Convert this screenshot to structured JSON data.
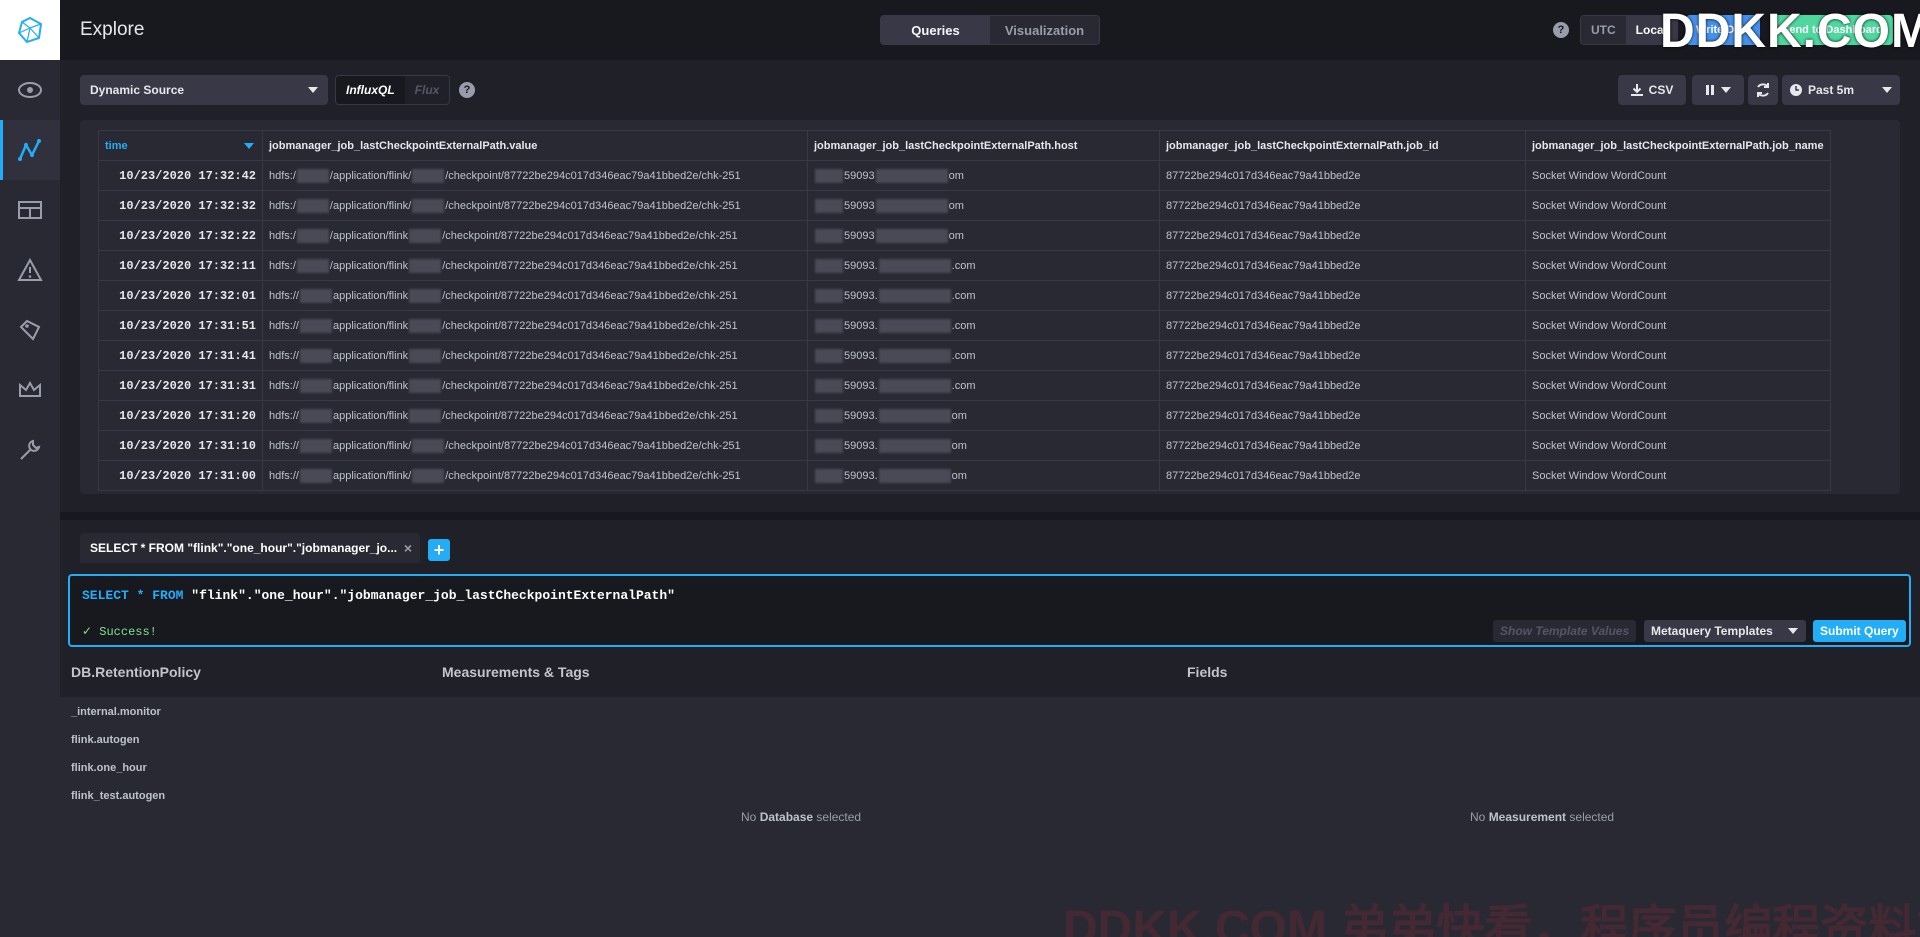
{
  "header": {
    "title": "Explore",
    "mode_tabs": [
      "Queries",
      "Visualization"
    ],
    "timezones": [
      "UTC",
      "Local"
    ],
    "write_data_label": "Write Data",
    "send_dashboard_label": "Send to Dashboard",
    "help": "?"
  },
  "watermark_top": "DDKK.COM",
  "watermark_bottom": "DDKK.COM 弟弟快看，程序员编程资料站",
  "toolbar": {
    "source": "Dynamic Source",
    "lang_influxql": "InfluxQL",
    "lang_flux": "Flux",
    "csv": "CSV",
    "time_range": "Past 5m",
    "help": "?"
  },
  "table": {
    "columns": [
      "time",
      "jobmanager_job_lastCheckpointExternalPath.value",
      "jobmanager_job_lastCheckpointExternalPath.host",
      "jobmanager_job_lastCheckpointExternalPath.job_id",
      "jobmanager_job_lastCheckpointExternalPath.job_name"
    ],
    "rows": [
      {
        "time": "10/23/2020 17:32:42",
        "value_pre": "hdfs:/",
        "value_mid": "/application/flink/",
        "value_post": "/checkpoint/87722be294c017d346eac79a41bbed2e/chk-251",
        "host_mid": "59093",
        "host_post": "om",
        "job_id": "87722be294c017d346eac79a41bbed2e",
        "job_name": "Socket Window WordCount"
      },
      {
        "time": "10/23/2020 17:32:32",
        "value_pre": "hdfs:/",
        "value_mid": "/application/flink/",
        "value_post": "/checkpoint/87722be294c017d346eac79a41bbed2e/chk-251",
        "host_mid": "59093",
        "host_post": "om",
        "job_id": "87722be294c017d346eac79a41bbed2e",
        "job_name": "Socket Window WordCount"
      },
      {
        "time": "10/23/2020 17:32:22",
        "value_pre": "hdfs:/",
        "value_mid": "/application/flink",
        "value_post": "/checkpoint/87722be294c017d346eac79a41bbed2e/chk-251",
        "host_mid": "59093",
        "host_post": "om",
        "job_id": "87722be294c017d346eac79a41bbed2e",
        "job_name": "Socket Window WordCount"
      },
      {
        "time": "10/23/2020 17:32:11",
        "value_pre": "hdfs:/",
        "value_mid": "/application/flink",
        "value_post": "/checkpoint/87722be294c017d346eac79a41bbed2e/chk-251",
        "host_mid": "59093.",
        "host_post": ".com",
        "job_id": "87722be294c017d346eac79a41bbed2e",
        "job_name": "Socket Window WordCount"
      },
      {
        "time": "10/23/2020 17:32:01",
        "value_pre": "hdfs://",
        "value_mid": "application/flink",
        "value_post": "/checkpoint/87722be294c017d346eac79a41bbed2e/chk-251",
        "host_mid": "59093.",
        "host_post": ".com",
        "job_id": "87722be294c017d346eac79a41bbed2e",
        "job_name": "Socket Window WordCount"
      },
      {
        "time": "10/23/2020 17:31:51",
        "value_pre": "hdfs://",
        "value_mid": "application/flink",
        "value_post": "/checkpoint/87722be294c017d346eac79a41bbed2e/chk-251",
        "host_mid": "59093.",
        "host_post": ".com",
        "job_id": "87722be294c017d346eac79a41bbed2e",
        "job_name": "Socket Window WordCount"
      },
      {
        "time": "10/23/2020 17:31:41",
        "value_pre": "hdfs://",
        "value_mid": "application/flink",
        "value_post": "/checkpoint/87722be294c017d346eac79a41bbed2e/chk-251",
        "host_mid": "59093.",
        "host_post": ".com",
        "job_id": "87722be294c017d346eac79a41bbed2e",
        "job_name": "Socket Window WordCount"
      },
      {
        "time": "10/23/2020 17:31:31",
        "value_pre": "hdfs://",
        "value_mid": "application/flink",
        "value_post": "/checkpoint/87722be294c017d346eac79a41bbed2e/chk-251",
        "host_mid": "59093.",
        "host_post": ".com",
        "job_id": "87722be294c017d346eac79a41bbed2e",
        "job_name": "Socket Window WordCount"
      },
      {
        "time": "10/23/2020 17:31:20",
        "value_pre": "hdfs://",
        "value_mid": "application/flink",
        "value_post": "/checkpoint/87722be294c017d346eac79a41bbed2e/chk-251",
        "host_mid": "59093.",
        "host_post": "om",
        "job_id": "87722be294c017d346eac79a41bbed2e",
        "job_name": "Socket Window WordCount"
      },
      {
        "time": "10/23/2020 17:31:10",
        "value_pre": "hdfs://",
        "value_mid": "application/flink/",
        "value_post": "/checkpoint/87722be294c017d346eac79a41bbed2e/chk-251",
        "host_mid": "59093.",
        "host_post": "om",
        "job_id": "87722be294c017d346eac79a41bbed2e",
        "job_name": "Socket Window WordCount"
      },
      {
        "time": "10/23/2020 17:31:00",
        "value_pre": "hdfs://",
        "value_mid": "application/flink/",
        "value_post": "/checkpoint/87722be294c017d346eac79a41bbed2e/chk-251",
        "host_mid": "59093.",
        "host_post": "om",
        "job_id": "87722be294c017d346eac79a41bbed2e",
        "job_name": "Socket Window WordCount"
      }
    ]
  },
  "query": {
    "tab_label": "SELECT * FROM \"flink\".\"one_hour\".\"jobmanager_jo...",
    "close": "×",
    "add": "+",
    "kw_select": "SELECT",
    "star": "*",
    "kw_from": "FROM",
    "target": "\"flink\".\"one_hour\".\"jobmanager_job_lastCheckpointExternalPath\"",
    "status": "Success!",
    "show_template_values": "Show Template Values",
    "metaquery_templates": "Metaquery Templates",
    "submit": "Submit Query"
  },
  "schema": {
    "db_header": "DB.RetentionPolicy",
    "measurements_header": "Measurements & Tags",
    "fields_header": "Fields",
    "databases": [
      "_internal.monitor",
      "flink.autogen",
      "flink.one_hour",
      "flink_test.autogen"
    ],
    "no_db": {
      "pre": "No ",
      "bold": "Database",
      "post": " selected"
    },
    "no_measurement": {
      "pre": "No ",
      "bold": "Measurement",
      "post": " selected"
    }
  },
  "colors": {
    "accent": "#22adf6",
    "success": "#7ce490",
    "write_data": "#4591ed",
    "send_dashboard": "#4ed8a0"
  }
}
